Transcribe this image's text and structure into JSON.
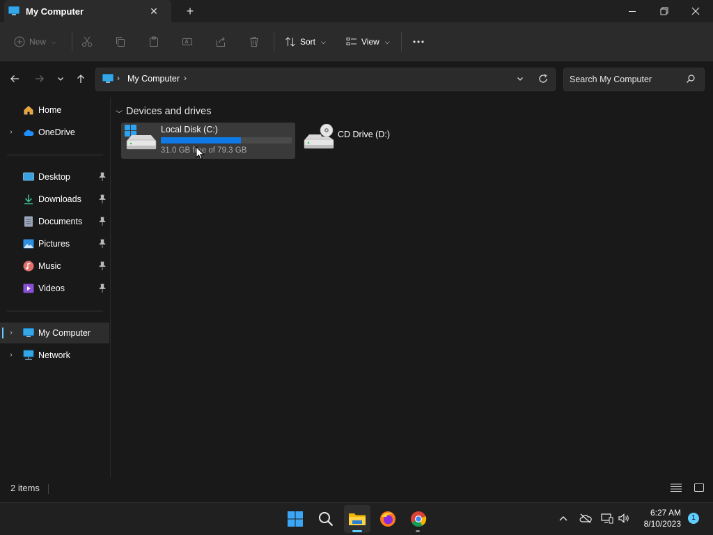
{
  "window": {
    "tab_title": "My Computer",
    "tab_close_glyph": "✕",
    "new_tab_glyph": "+"
  },
  "toolbar": {
    "new_label": "New",
    "sort_label": "Sort",
    "view_label": "View"
  },
  "address": {
    "path": "My Computer",
    "separator": "›"
  },
  "search": {
    "placeholder": "Search My Computer"
  },
  "sidebar": {
    "quick": [
      {
        "label": "Home",
        "icon": "home-icon"
      },
      {
        "label": "OneDrive",
        "icon": "onedrive-icon"
      }
    ],
    "pinned": [
      {
        "label": "Desktop",
        "icon": "desktop-icon"
      },
      {
        "label": "Downloads",
        "icon": "downloads-icon"
      },
      {
        "label": "Documents",
        "icon": "documents-icon"
      },
      {
        "label": "Pictures",
        "icon": "pictures-icon"
      },
      {
        "label": "Music",
        "icon": "music-icon"
      },
      {
        "label": "Videos",
        "icon": "videos-icon"
      }
    ],
    "locations": [
      {
        "label": "My Computer",
        "icon": "computer-icon",
        "selected": true
      },
      {
        "label": "Network",
        "icon": "network-icon"
      }
    ]
  },
  "content": {
    "group_title": "Devices and drives",
    "drives": [
      {
        "name": "Local Disk (C:)",
        "free_text": "31.0 GB free of 79.3 GB",
        "used_fraction": 0.61
      },
      {
        "name": "CD Drive (D:)"
      }
    ]
  },
  "status": {
    "item_count": "2 items"
  },
  "taskbar": {
    "time": "6:27 AM",
    "date": "8/10/2023",
    "notification_count": "1"
  },
  "colors": {
    "accent": "#60cdff",
    "drive_bar": "#0f7ae5",
    "background": "#191919",
    "panel": "#2b2b2b"
  }
}
